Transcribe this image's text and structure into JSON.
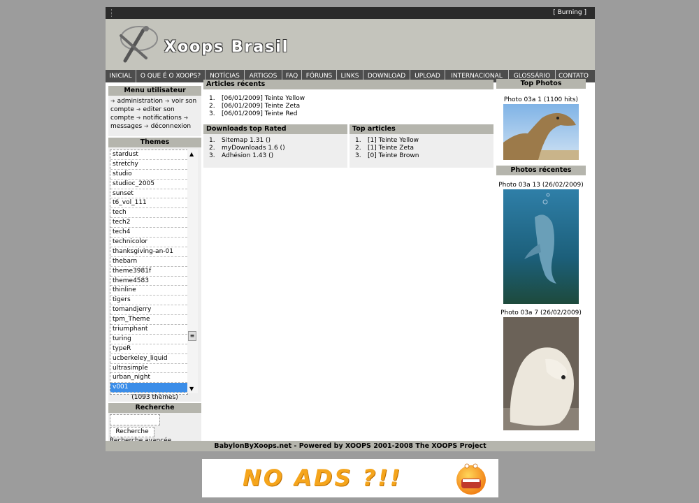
{
  "topbar": {
    "user_label": "[ Burning ]"
  },
  "header": {
    "site_name": "Xoops Brasil"
  },
  "nav": [
    "INICIAL",
    "O QUE É O XOOPS?",
    "NOTÍCIAS",
    "ARTIGOS",
    "FAQ",
    "FÓRUNS",
    "LINKS",
    "DOWNLOAD",
    "UPLOAD",
    "INTERNACIONAL",
    "GLOSSÁRIO",
    "CONTATO"
  ],
  "user_menu": {
    "title": "Menu utilisateur",
    "items": [
      "administration",
      "voir son compte",
      "editer son compte",
      "notifications",
      "messages",
      "déconnexion"
    ]
  },
  "themes": {
    "title": "Themes",
    "items": [
      "stardust",
      "stretchy",
      "studio",
      "studioc_2005",
      "sunset",
      "t6_vol_111",
      "tech",
      "tech2",
      "tech4",
      "technicolor",
      "thanksgiving-an-01",
      "thebarn",
      "theme3981f",
      "theme4583",
      "thinline",
      "tigers",
      "tomandjerry",
      "tpm_Theme",
      "triumphant",
      "turing",
      "typeR",
      "ucberkeley_liquid",
      "ultrasimple",
      "urban_night",
      "v001"
    ],
    "selected": "v001",
    "count": "(1093 thèmes)"
  },
  "search": {
    "title": "Recherche",
    "button": "Recherche",
    "advanced": "Recherche avancée"
  },
  "recent_articles": {
    "title": "Articles récents",
    "items": [
      {
        "num": "1.",
        "text": "[06/01/2009] Teinte Yellow"
      },
      {
        "num": "2.",
        "text": "[06/01/2009] Teinte Zeta"
      },
      {
        "num": "3.",
        "text": "[06/01/2009] Teinte Red"
      }
    ]
  },
  "downloads": {
    "title": "Downloads top Rated",
    "items": [
      {
        "num": "1.",
        "text": "Sitemap 1.31 ()"
      },
      {
        "num": "2.",
        "text": "myDownloads 1.6 ()"
      },
      {
        "num": "3.",
        "text": "Adhésion 1.43 ()"
      }
    ]
  },
  "top_articles": {
    "title": "Top articles",
    "items": [
      {
        "num": "1.",
        "text": "[1] Teinte Yellow"
      },
      {
        "num": "2.",
        "text": "[1] Teinte Zeta"
      },
      {
        "num": "3.",
        "text": "[0] Teinte Brown"
      }
    ]
  },
  "top_photos": {
    "title": "Top Photos",
    "caption": "Photo 03a 1 (1100 hits)"
  },
  "recent_photos": {
    "title": "Photos récentes",
    "captions": [
      "Photo 03a 13 (26/02/2009)",
      "Photo 03a 7 (26/02/2009)"
    ]
  },
  "footer": {
    "text": "BabylonByXoops.net - Powered by XOOPS 2001-2008 The XOOPS Project"
  },
  "ad": {
    "text": "NO ADS ?!!"
  }
}
